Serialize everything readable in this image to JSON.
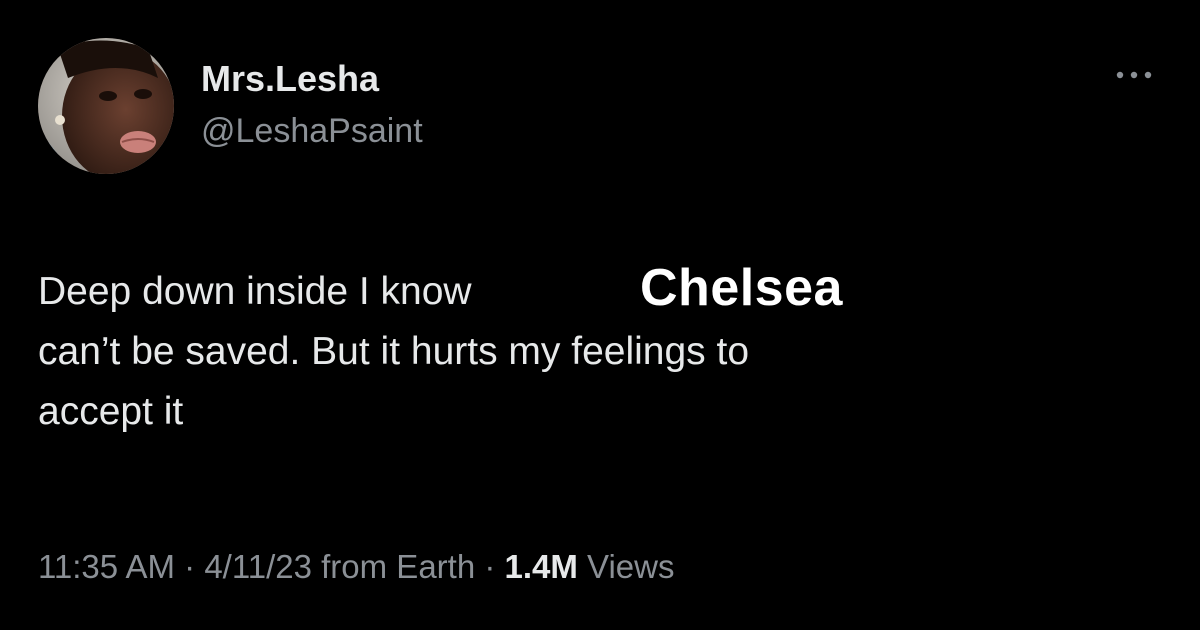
{
  "user": {
    "display_name": "Mrs.Lesha",
    "handle": "@LeshaPsaint",
    "avatar_icon": "profile-photo"
  },
  "more_icon": "more-horizontal-icon",
  "tweet": {
    "line1": "Deep down inside I know",
    "overlay_word": "Chelsea",
    "line2": "can’t be saved. But it hurts my feelings to",
    "line3": "accept it"
  },
  "meta": {
    "time": "11:35 AM",
    "sep1": " · ",
    "date": "4/11/23",
    "source": " from Earth",
    "sep2": " · ",
    "views_count": "1.4M",
    "views_label": " Views"
  },
  "colors": {
    "background": "#000000",
    "primary_text": "#e7e9ea",
    "secondary_text": "#8b9096"
  }
}
